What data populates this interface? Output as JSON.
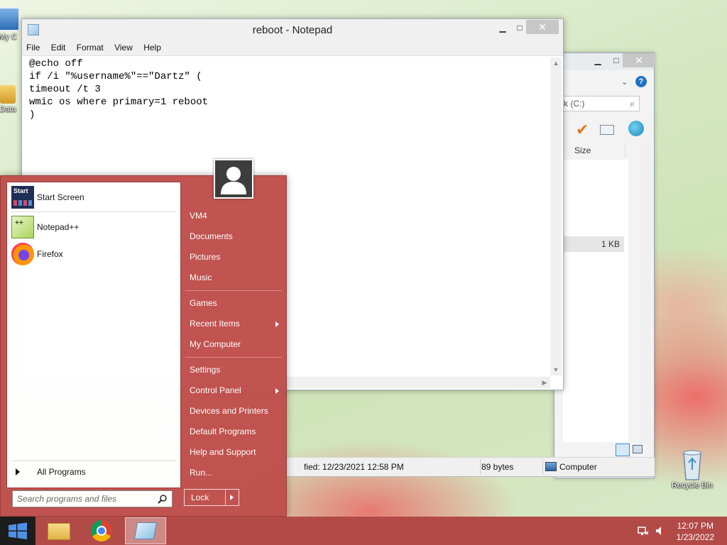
{
  "desktop": {
    "icons": [
      {
        "label": "My C",
        "icon": "computer-icon"
      },
      {
        "label": "Data",
        "icon": "data-icon"
      },
      {
        "label": "Recycle Bin",
        "icon": "recycle-bin-icon"
      }
    ]
  },
  "notepad": {
    "title": "reboot - Notepad",
    "menu": [
      "File",
      "Edit",
      "Format",
      "View",
      "Help"
    ],
    "content": "@echo off\nif /i \"%username%\"==\"Dartz\" (\ntimeout /t 3\nwmic os where primary=1 reboot\n)",
    "minimize": "▁",
    "maximize": "□",
    "close": "✕"
  },
  "explorer": {
    "search_text": "k (C:)",
    "column_size": "Size",
    "file_size": "1 KB",
    "minimize": "▁",
    "maximize": "□",
    "close": "✕",
    "help": "?"
  },
  "statusbar": {
    "modified": "fied: 12/23/2021 12:58 PM",
    "size": "89 bytes",
    "location": "Computer"
  },
  "startmenu": {
    "programs": [
      {
        "label": "Start Screen",
        "icon": "start-screen-icon"
      },
      {
        "label": "Notepad++",
        "icon": "notepadpp-icon"
      },
      {
        "label": "Firefox",
        "icon": "firefox-icon"
      }
    ],
    "all_programs": "All Programs",
    "search_placeholder": "Search programs and files",
    "right_items": [
      {
        "label": "VM4",
        "submenu": false
      },
      {
        "label": "Documents",
        "submenu": false
      },
      {
        "label": "Pictures",
        "submenu": false
      },
      {
        "label": "Music",
        "submenu": false
      },
      {
        "label": "Games",
        "submenu": false
      },
      {
        "label": "Recent Items",
        "submenu": true
      },
      {
        "label": "My Computer",
        "submenu": false
      },
      {
        "label": "Settings",
        "submenu": false
      },
      {
        "label": "Control Panel",
        "submenu": true
      },
      {
        "label": "Devices and Printers",
        "submenu": false
      },
      {
        "label": "Default Programs",
        "submenu": false
      },
      {
        "label": "Help and Support",
        "submenu": false
      },
      {
        "label": "Run...",
        "submenu": false
      }
    ],
    "lock_label": "Lock",
    "start_tile_text": "Start"
  },
  "taskbar": {
    "items": [
      "file-explorer-icon",
      "chrome-icon",
      "notepad-icon"
    ],
    "active_item": "notepad-icon",
    "time": "12:07 PM",
    "date": "1/23/2022"
  },
  "colors": {
    "accent": "#c0504d",
    "taskbar": "#b24a47"
  }
}
